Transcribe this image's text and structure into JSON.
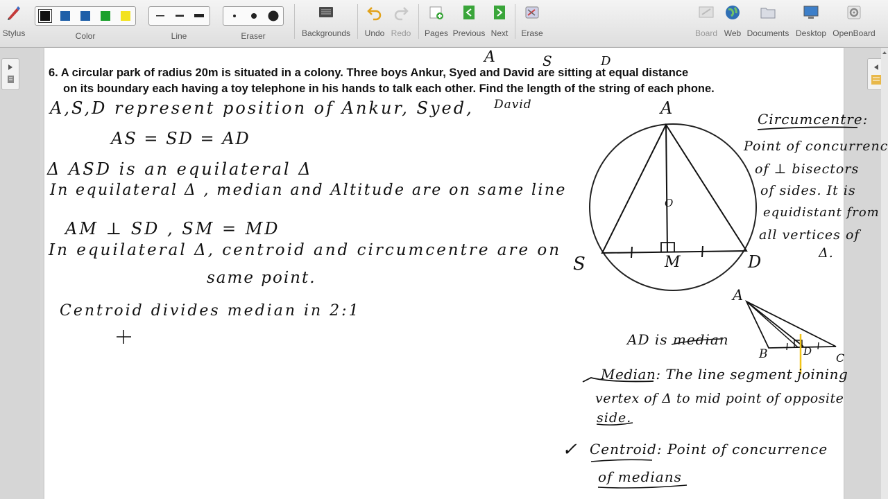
{
  "toolbar": {
    "stylus": "Stylus",
    "color": "Color",
    "line": "Line",
    "eraser": "Eraser",
    "backgrounds": "Backgrounds",
    "undo": "Undo",
    "redo": "Redo",
    "pages": "Pages",
    "previous": "Previous",
    "next": "Next",
    "erase": "Erase",
    "board": "Board",
    "web": "Web",
    "documents": "Documents",
    "desktop": "Desktop",
    "openboard": "OpenBoard"
  },
  "palette_colors": [
    "#111111",
    "#1f5fa8",
    "#1f5fa8",
    "#1aa02c",
    "#f2e21e"
  ],
  "question": {
    "line1": "6. A circular park of radius 20m is situated in a colony. Three boys Ankur, Syed and David are sitting at equal distance",
    "line2": "on its boundary each having a toy telephone in his hands to talk each other. Find the length of the string of each phone.",
    "ann_a": "A",
    "ann_s": "S",
    "ann_d": "D"
  },
  "notes": {
    "l1a": "A,S,D represent position of Ankur, Syed,",
    "l1b": "David",
    "l2": "AS = SD = AD",
    "l3": "Δ ASD is an equilateral Δ",
    "l4": "In equilateral Δ , median and Altitude are on same line",
    "l5": "AM ⊥ SD , SM = MD",
    "l6": "In equilateral Δ, centroid and circumcentre are on",
    "l7": "same point.",
    "l8": "Centroid divides median in 2:1"
  },
  "figure": {
    "a": "A",
    "s": "S",
    "d": "D",
    "m": "M",
    "o": "O",
    "circ_title": "Circumcentre:",
    "circ1": "Point of concurrence",
    "circ2": "of ⊥ bisectors",
    "circ3": "of sides. It is",
    "circ4": "equidistant from",
    "circ5": "all vertices of",
    "circ6": "Δ.",
    "t2_a": "A",
    "t2_b": "B",
    "t2_d": "D",
    "t2_c": "C",
    "ad_median": "AD is median",
    "median1": "Median: The line segment joining",
    "median2": "vertex of Δ to mid point of opposite",
    "median3": "side.",
    "centroid1": "Centroid: Point of concurrence",
    "centroid2": "of medians",
    "check": "✓"
  }
}
